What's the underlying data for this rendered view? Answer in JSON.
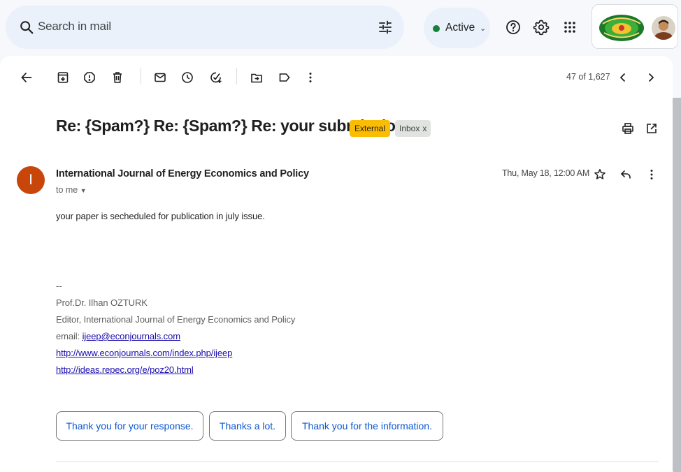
{
  "search": {
    "placeholder": "Search in mail",
    "icon": "search-icon",
    "filter_icon": "tune-icon"
  },
  "status": {
    "label": "Active",
    "color": "#188038"
  },
  "header_icons": [
    "help-icon",
    "settings-icon",
    "apps-icon"
  ],
  "toolbar": {
    "actions": [
      "back",
      "archive",
      "report-spam",
      "delete",
      "mark-unread",
      "snooze",
      "add-to-tasks",
      "move-to",
      "labels",
      "more"
    ],
    "counter": "47 of 1,627"
  },
  "email": {
    "subject": "Re: {Spam?} Re: {Spam?} Re: your submission",
    "labels": {
      "external": "External",
      "inbox": "Inbox",
      "inbox_close": "x"
    },
    "sender": {
      "initial": "I",
      "name": "International Journal of Energy Economics and Policy",
      "to": "to me",
      "avatar_color": "#c9460b"
    },
    "date": "Thu, May 18, 12:00 AM",
    "body": "your paper is secheduled for publication in july issue.",
    "signature": {
      "separator": "--",
      "name": "Prof.Dr. Ilhan OZTURK",
      "title": "Editor, International Journal of Energy Economics and Policy",
      "email_label": "email:",
      "email": "ijeep@econjournals.com",
      "link1": "http://www.econjournals.com/index.php/ijeep",
      "link2": "http://ideas.repec.org/e/poz20.html"
    }
  },
  "smart_replies": [
    "Thank you for your response.",
    "Thanks a lot.",
    "Thank you for the information."
  ],
  "colors": {
    "accent": "#0b57d0",
    "external_badge": "#fbbc04",
    "link": "#1a0dab"
  }
}
